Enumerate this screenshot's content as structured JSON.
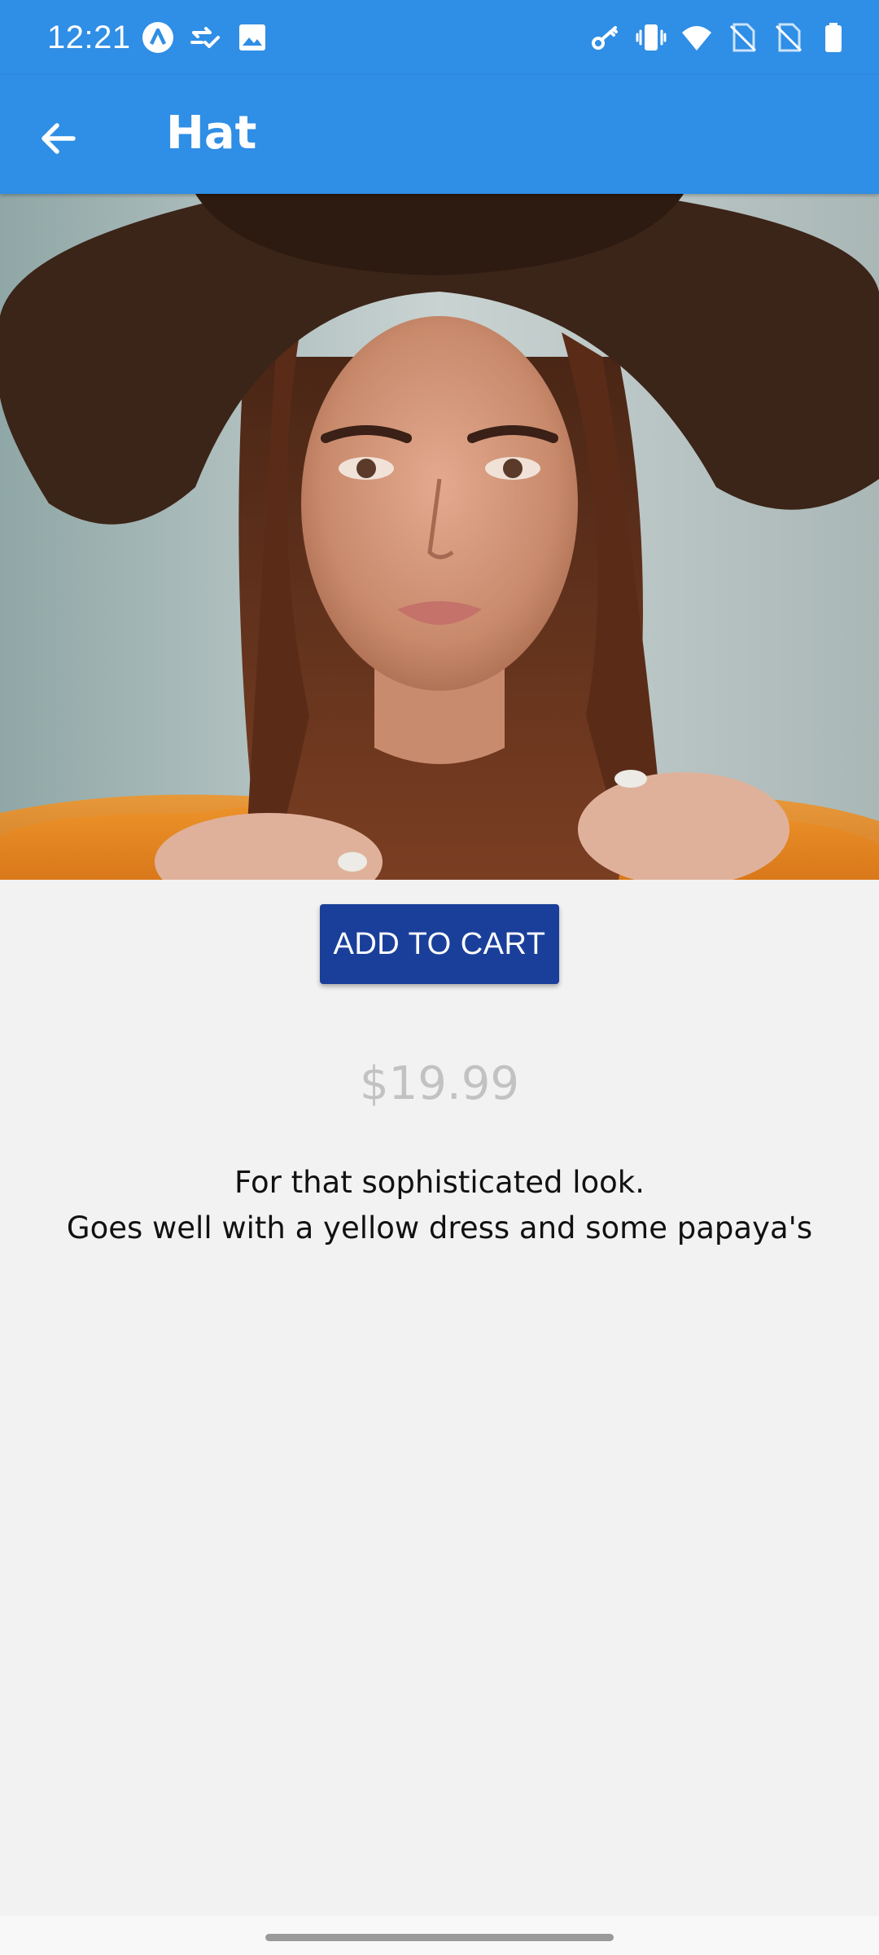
{
  "status_bar": {
    "time": "12:21",
    "left_icons": [
      "a-logo-icon",
      "sync-check-icon",
      "image-icon"
    ],
    "right_icons": [
      "vpn-key-icon",
      "vibrate-icon",
      "wifi-icon",
      "no-sim-icon",
      "no-sim-icon",
      "battery-icon"
    ]
  },
  "app_bar": {
    "title": "Hat",
    "back_icon": "arrow-left-icon",
    "color": "#2f8ee5"
  },
  "product": {
    "image": "woman-in-brown-hat-photo",
    "add_to_cart_label": "ADD TO CART",
    "price": "$19.99",
    "description_lines": [
      "For that sophisticated look.",
      "Goes well with a yellow dress and some papaya's"
    ]
  },
  "colors": {
    "accent": "#2f8ee5",
    "button": "#1a3f9a",
    "background": "#f2f2f2",
    "price_text": "#c2c2c2"
  }
}
